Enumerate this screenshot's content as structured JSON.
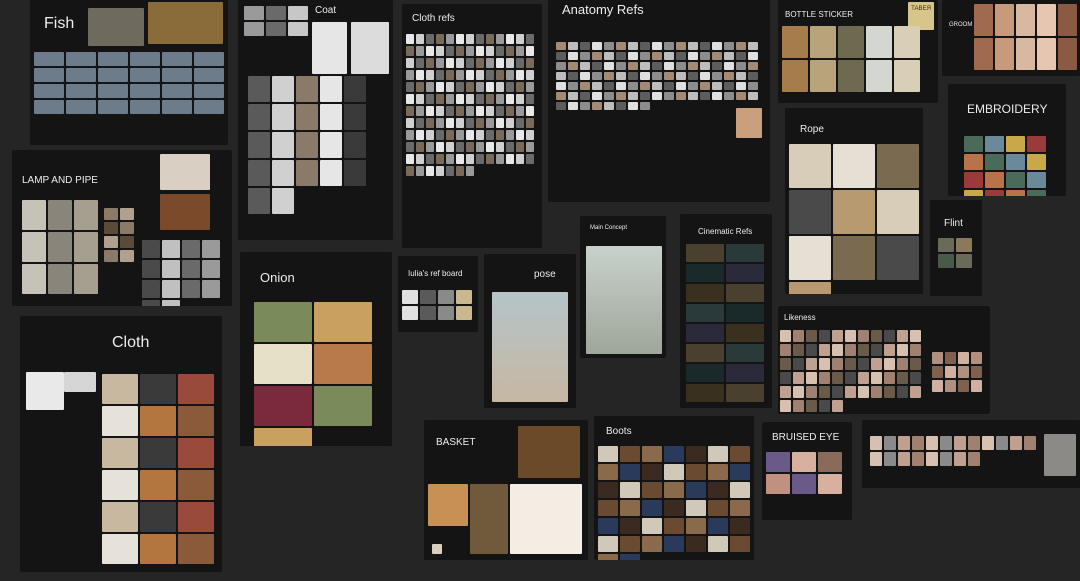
{
  "boards": {
    "fish": "Fish",
    "coat": "Coat",
    "cloth_refs": "Cloth refs",
    "anatomy_refs": "Anatomy Refs",
    "bottle_sticker": "BOTTLE STICKER",
    "groom": "GROOM",
    "embroidery": "EMBROIDERY",
    "lamp_and_pipe": "LAMP AND PIPE",
    "rope": "Rope",
    "flint": "Flint",
    "cloth": "Cloth",
    "onion": "Onion",
    "iulias_ref_board": "Iulia's ref board",
    "pose": "pose",
    "main_concept": "Main Concept",
    "cinematic_refs": "Cinematic Refs",
    "likeness": "Likeness",
    "basket": "BASKET",
    "boots": "Boots",
    "bruised_eye": "BRUISED EYE"
  },
  "bottle_label_text": "ТАВЕЯ",
  "icons": [
    "fish-photo",
    "pipe-photo",
    "coat-photo",
    "basket-photo",
    "portrait-photo"
  ],
  "colors": {
    "canvas": "#252525",
    "board": "#141414",
    "text": "#ececec"
  }
}
